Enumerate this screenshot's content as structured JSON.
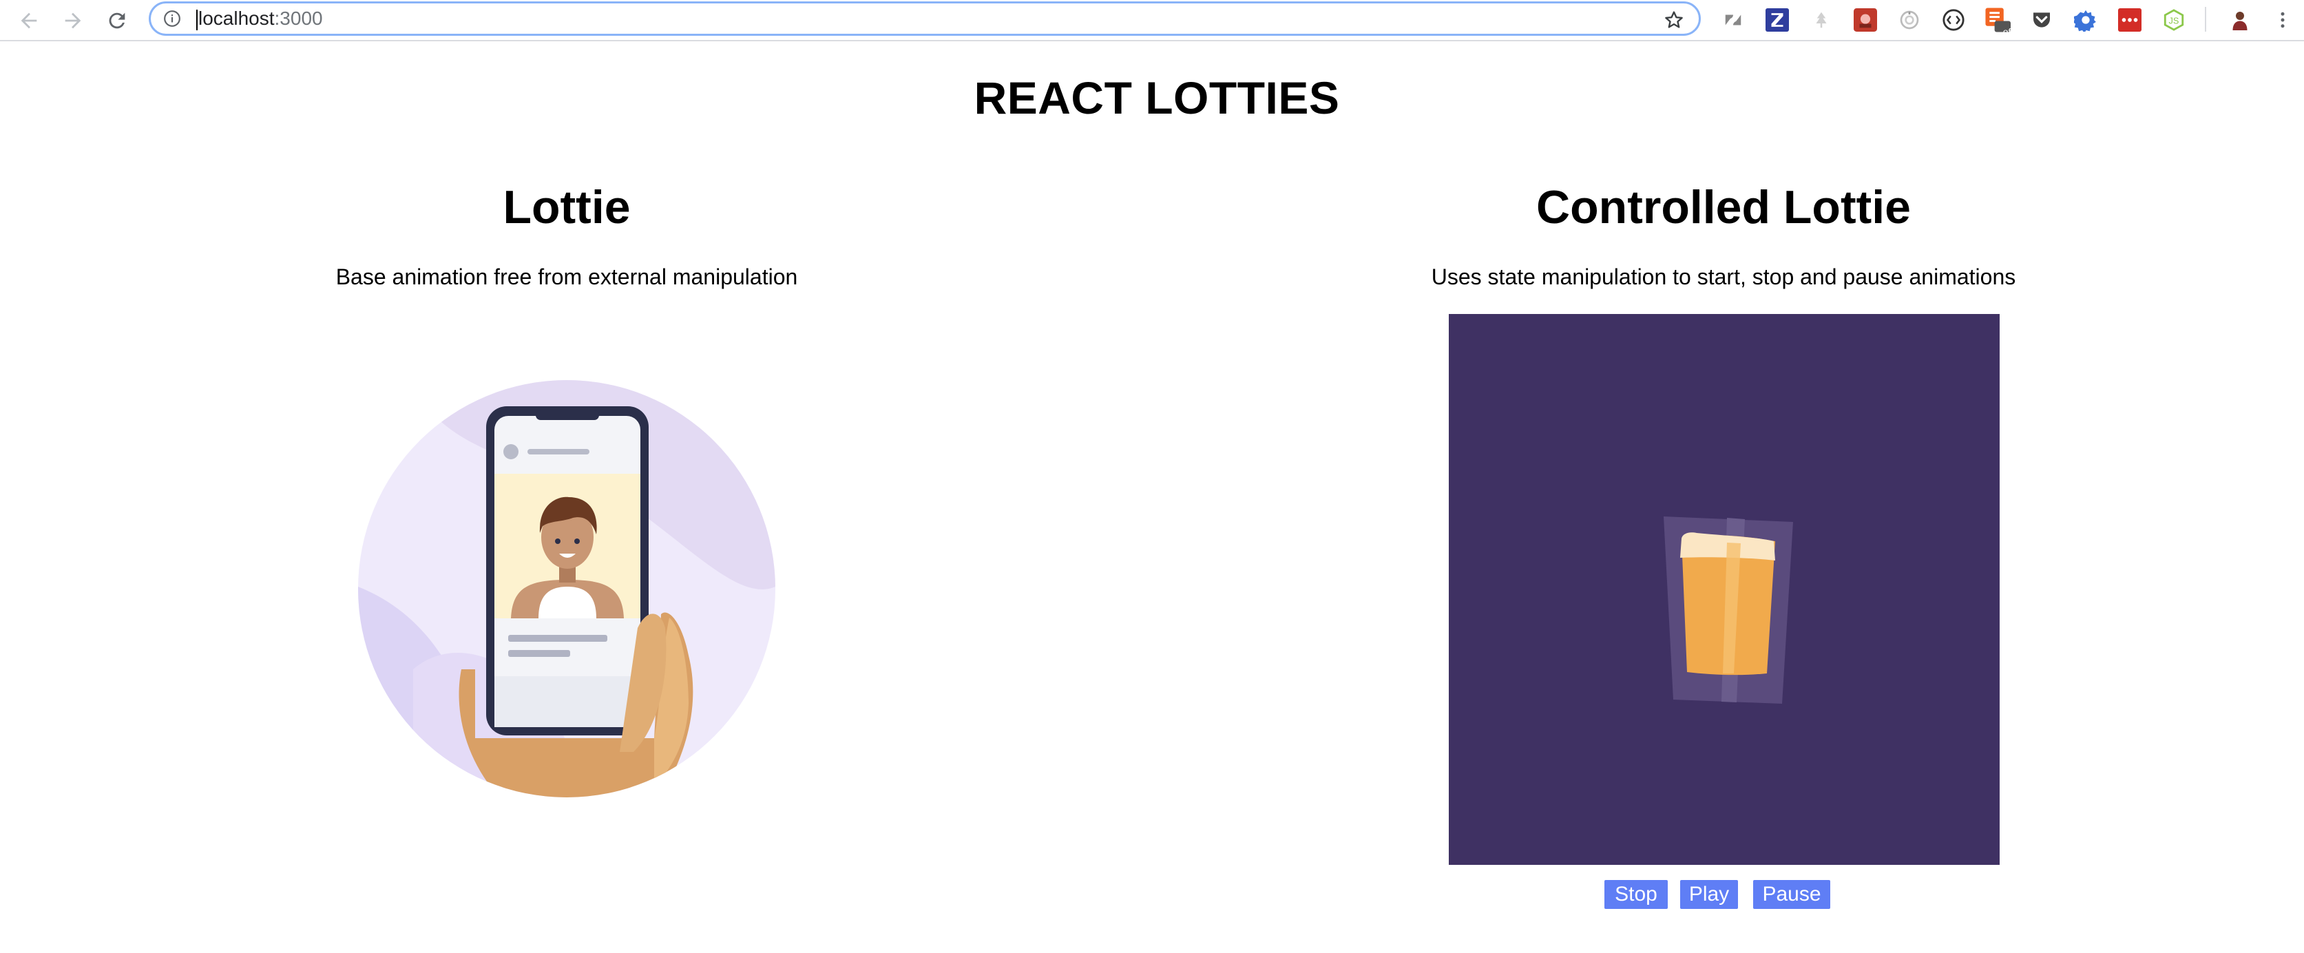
{
  "browser": {
    "url_host": "localhost",
    "url_port": ":3000",
    "icons": {
      "back": "back-arrow-icon",
      "forward": "forward-arrow-icon",
      "reload": "reload-icon",
      "info": "info-icon",
      "bookmark": "star-icon"
    },
    "extensions": [
      "zendesk-extension-icon",
      "z-extension-icon",
      "tree-extension-icon",
      "red-extension-icon",
      "clock-extension-icon",
      "devtools-extension-icon",
      "off-extension-icon",
      "pocket-extension-icon",
      "gear-extension-icon",
      "lastpass-extension-icon",
      "nodejs-extension-icon"
    ],
    "ext_badge": "off",
    "accent": "#8ab4f8"
  },
  "page": {
    "title": "REACT LOTTIES",
    "left": {
      "title": "Lottie",
      "description": "Base animation free from external manipulation"
    },
    "right": {
      "title": "Controlled Lottie",
      "description": "Uses state manipulation to start, stop and pause animations",
      "background": "#3f3163"
    },
    "controls": {
      "stop": "Stop",
      "play": "Play",
      "pause": "Pause",
      "color": "#5f7ef5"
    }
  }
}
